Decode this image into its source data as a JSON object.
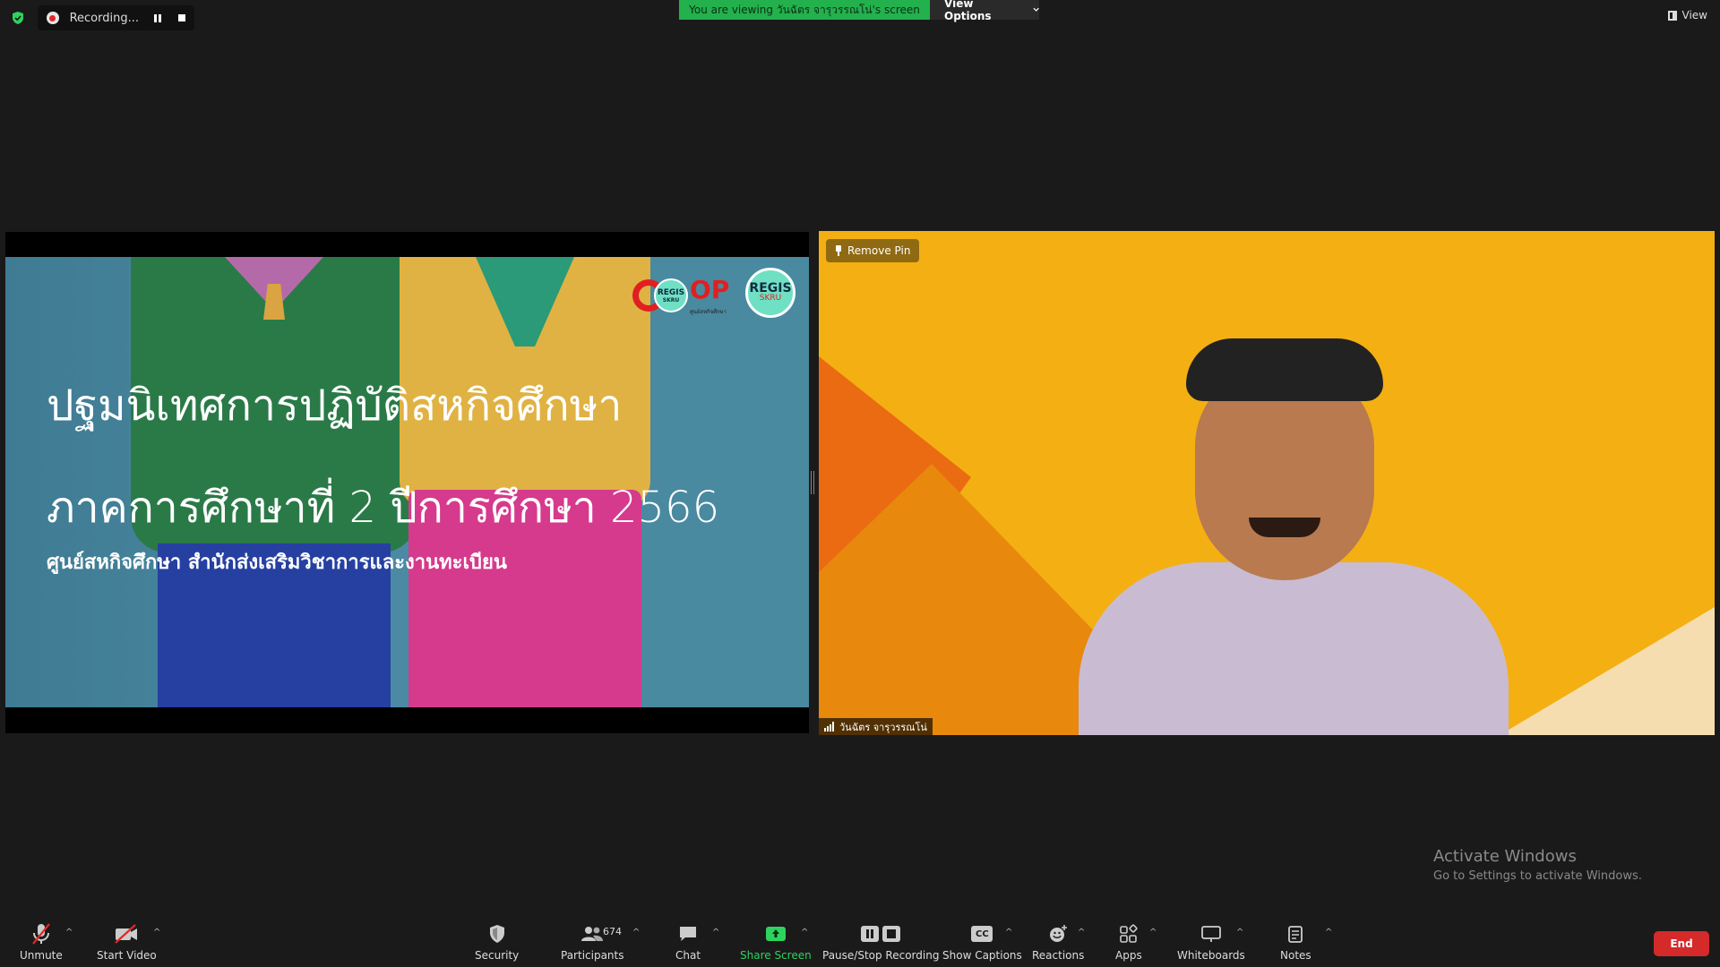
{
  "top_bar": {
    "recording_label": "Recording...",
    "viewing_banner": "You are viewing วันฉัตร จารุวรรณโน่'s screen",
    "view_options_label": "View Options",
    "view_label": "View"
  },
  "slide": {
    "title_line1": "ปฐมนิเทศการปฏิบัติสหกิจศึกษา",
    "title_line2": "ภาคการศึกษาที่ 2 ปีการศึกษา 2566",
    "subtitle": "ศูนย์สหกิจศึกษา สำนักส่งเสริมวิชาการและงานทะเบียน",
    "logo_coop_op": "OP",
    "logo_regis_small_top": "REGIS",
    "logo_regis_small_bottom": "SKRU",
    "logo_coop_sub": "ศูนย์สหกิจศึกษา",
    "logo_regis_top": "REGIS",
    "logo_regis_bottom": "SKRU"
  },
  "video": {
    "remove_pin_label": "Remove Pin",
    "participant_name": "วันฉัตร จารุวรรณโน่"
  },
  "watermark": {
    "line1": "Activate Windows",
    "line2": "Go to Settings to activate Windows."
  },
  "toolbar": {
    "unmute": "Unmute",
    "start_video": "Start Video",
    "security": "Security",
    "participants": "Participants",
    "participant_count": "674",
    "chat": "Chat",
    "share_screen": "Share Screen",
    "pause_stop_recording": "Pause/Stop Recording",
    "show_captions": "Show Captions",
    "captions_badge": "CC",
    "reactions": "Reactions",
    "apps": "Apps",
    "whiteboards": "Whiteboards",
    "notes": "Notes",
    "end": "End"
  },
  "icons": [
    "shield-icon",
    "record-icon",
    "pause-icon",
    "stop-icon",
    "chevron-down-icon",
    "pin-icon",
    "signal-icon",
    "mic-muted-icon",
    "video-off-icon",
    "security-shield-icon",
    "participants-icon",
    "chat-icon",
    "share-screen-icon",
    "captions-icon",
    "reactions-icon",
    "apps-icon",
    "whiteboard-icon",
    "notes-icon"
  ],
  "colors": {
    "background": "#1a1a1a",
    "viewing_banner": "#22b14c",
    "share_screen_accent": "#2ed35e",
    "end_button": "#d42a2a",
    "video_background": "#f4b012"
  }
}
